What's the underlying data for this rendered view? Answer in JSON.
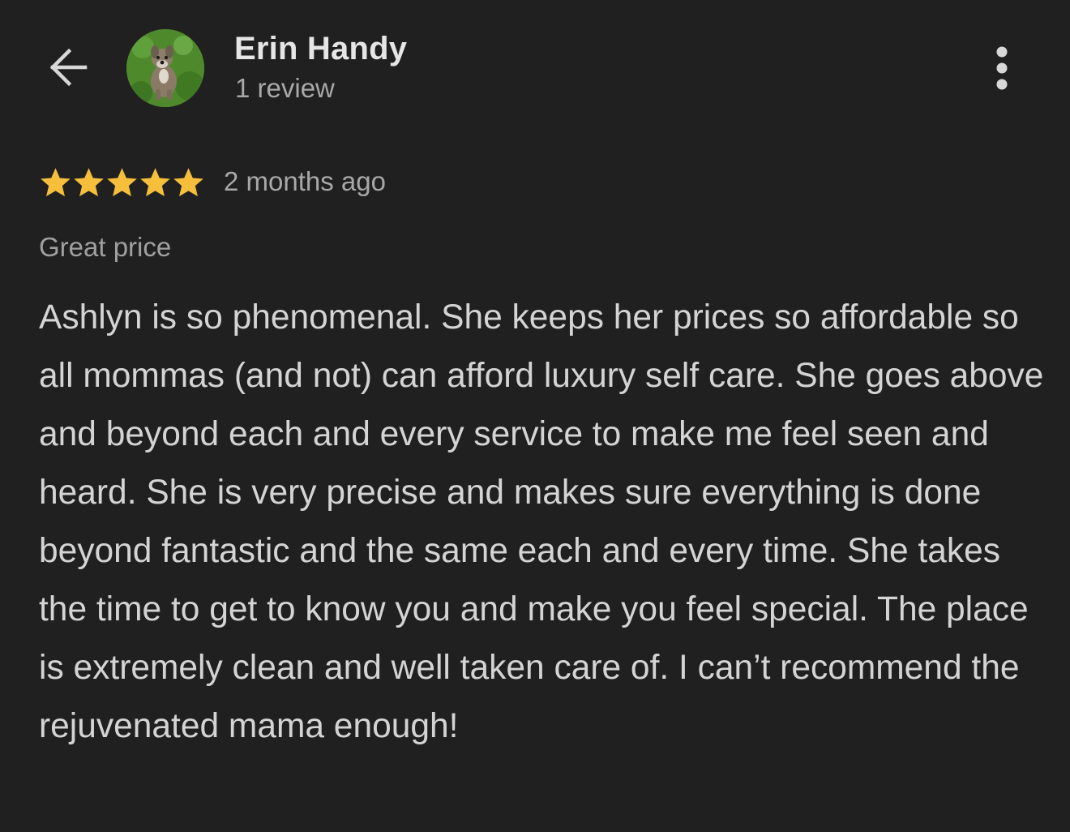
{
  "header": {
    "back_icon": "arrow-left-icon",
    "avatar_alt": "Erin Handy",
    "reviewer_name": "Erin Handy",
    "review_count": "1 review",
    "more_icon": "more-vertical-icon"
  },
  "review": {
    "rating": 5,
    "rating_max": 5,
    "star_color": "#f5bf3c",
    "date": "2 months ago",
    "highlight": "Great price",
    "text": "Ashlyn is so phenomenal. She keeps her prices so affordable so all mommas (and not) can afford luxury self care. She goes above and beyond each and every service to make me feel seen and heard. She is very precise and makes sure everything is done beyond fantastic and the same each and every time. She takes the time to get to know you and make you feel special. The place is extremely clean and well taken care of. I can’t recommend the rejuvenated mama enough!"
  },
  "colors": {
    "background": "#202020",
    "primary_text": "#e6e6e6",
    "secondary_text": "#a8a8a8"
  }
}
